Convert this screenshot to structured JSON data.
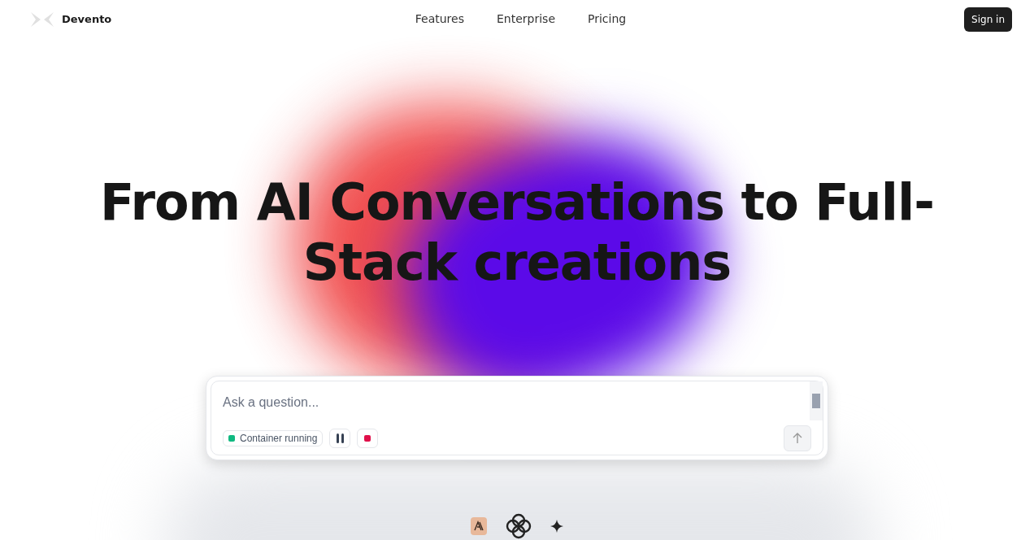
{
  "brand": {
    "name": "Devento"
  },
  "nav": [
    {
      "label": "Features"
    },
    {
      "label": "Enterprise"
    },
    {
      "label": "Pricing"
    }
  ],
  "sign_in": "Sign in",
  "hero": {
    "title": "From AI Conversations to Full-Stack creations"
  },
  "prompt": {
    "placeholder": "Ask a question...",
    "status": {
      "label": "Container running",
      "color": "#10b981"
    }
  }
}
